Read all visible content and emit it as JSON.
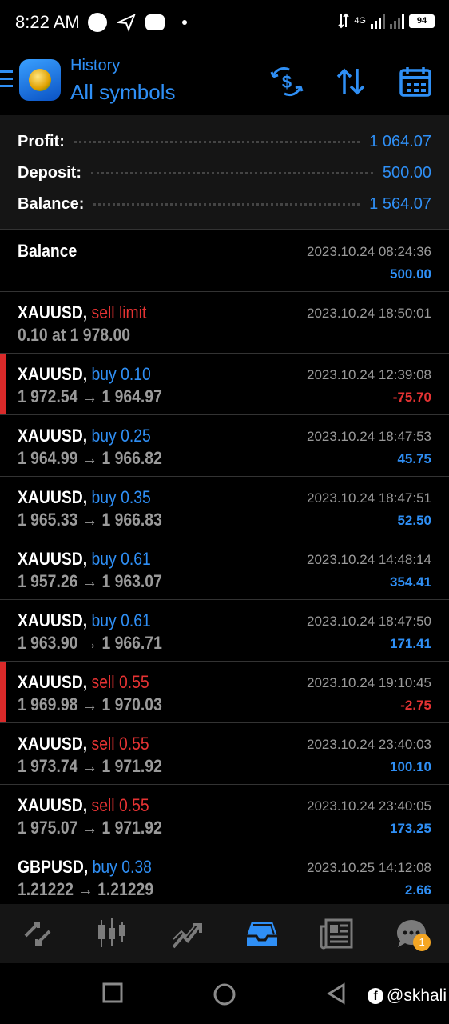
{
  "status_bar": {
    "time": "8:22 AM",
    "network": "4G",
    "battery": "94"
  },
  "header": {
    "subtitle": "History",
    "title": "All symbols",
    "icons": [
      "menu-icon",
      "metatrader-logo",
      "dollar-sort-icon",
      "sort-arrows-icon",
      "calendar-icon"
    ]
  },
  "summary": {
    "profit_label": "Profit:",
    "profit_value": "1 064.07",
    "deposit_label": "Deposit:",
    "deposit_value": "500.00",
    "balance_label": "Balance:",
    "balance_value": "1 564.07"
  },
  "colors": {
    "accent": "#2f8ff5",
    "loss": "#e53333",
    "background": "#000000",
    "panel": "#151515"
  },
  "entries": [
    {
      "symbol": "Balance",
      "side": "",
      "side_type": "",
      "prices": "",
      "date": "2023.10.24 08:24:36",
      "pnl": "500.00",
      "pnl_type": "pos",
      "marker": false
    },
    {
      "symbol": "XAUUSD,",
      "side": "sell limit",
      "side_type": "sell",
      "prices": "0.10 at 1 978.00",
      "date": "2023.10.24 18:50:01",
      "pnl": "",
      "pnl_type": "",
      "marker": false
    },
    {
      "symbol": "XAUUSD,",
      "side": "buy 0.10",
      "side_type": "buy",
      "prices": "1 972.54 → 1 964.97",
      "date": "2023.10.24 12:39:08",
      "pnl": "-75.70",
      "pnl_type": "neg",
      "marker": true
    },
    {
      "symbol": "XAUUSD,",
      "side": "buy 0.25",
      "side_type": "buy",
      "prices": "1 964.99 → 1 966.82",
      "date": "2023.10.24 18:47:53",
      "pnl": "45.75",
      "pnl_type": "pos",
      "marker": false
    },
    {
      "symbol": "XAUUSD,",
      "side": "buy 0.35",
      "side_type": "buy",
      "prices": "1 965.33 → 1 966.83",
      "date": "2023.10.24 18:47:51",
      "pnl": "52.50",
      "pnl_type": "pos",
      "marker": false
    },
    {
      "symbol": "XAUUSD,",
      "side": "buy 0.61",
      "side_type": "buy",
      "prices": "1 957.26 → 1 963.07",
      "date": "2023.10.24 14:48:14",
      "pnl": "354.41",
      "pnl_type": "pos",
      "marker": false
    },
    {
      "symbol": "XAUUSD,",
      "side": "buy 0.61",
      "side_type": "buy",
      "prices": "1 963.90 → 1 966.71",
      "date": "2023.10.24 18:47:50",
      "pnl": "171.41",
      "pnl_type": "pos",
      "marker": false
    },
    {
      "symbol": "XAUUSD,",
      "side": "sell 0.55",
      "side_type": "sell",
      "prices": "1 969.98 → 1 970.03",
      "date": "2023.10.24 19:10:45",
      "pnl": "-2.75",
      "pnl_type": "neg",
      "marker": true
    },
    {
      "symbol": "XAUUSD,",
      "side": "sell 0.55",
      "side_type": "sell",
      "prices": "1 973.74 → 1 971.92",
      "date": "2023.10.24 23:40:03",
      "pnl": "100.10",
      "pnl_type": "pos",
      "marker": false
    },
    {
      "symbol": "XAUUSD,",
      "side": "sell 0.55",
      "side_type": "sell",
      "prices": "1 975.07 → 1 971.92",
      "date": "2023.10.24 23:40:05",
      "pnl": "173.25",
      "pnl_type": "pos",
      "marker": false
    },
    {
      "symbol": "GBPUSD,",
      "side": "buy 0.38",
      "side_type": "buy",
      "prices": "1.21222 → 1.21229",
      "date": "2023.10.25 14:12:08",
      "pnl": "2.66",
      "pnl_type": "pos",
      "marker": false
    }
  ],
  "bottom_nav": {
    "items": [
      "quotes-icon",
      "chart-icon",
      "trade-icon",
      "history-icon",
      "news-icon",
      "chat-icon"
    ],
    "active": "history-icon",
    "chat_badge": "1"
  },
  "watermark": {
    "text": "@skhali"
  }
}
